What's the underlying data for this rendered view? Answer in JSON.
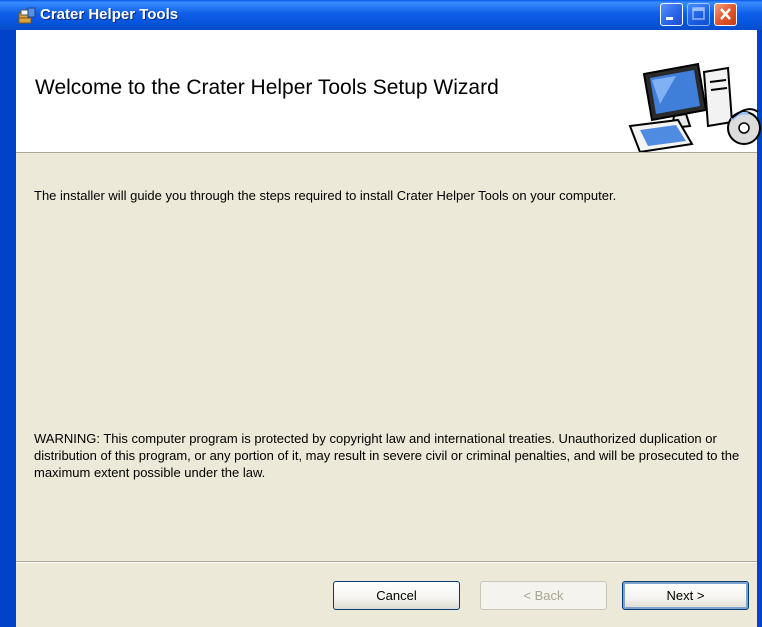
{
  "window": {
    "title": "Crater Helper Tools"
  },
  "banner": {
    "title": "Welcome to the Crater Helper Tools Setup Wizard",
    "art_icon": "computer-with-cd-icon"
  },
  "body": {
    "intro": "The installer will guide you through the steps required to install Crater Helper Tools on your computer.",
    "warning": "WARNING: This computer program is protected by copyright law and international treaties. Unauthorized duplication or distribution of this program, or any portion of it, may result in severe civil or criminal penalties, and will be prosecuted to the maximum extent possible under the law."
  },
  "buttons": {
    "cancel": "Cancel",
    "back": "< Back",
    "next": "Next >"
  },
  "colors": {
    "titlebar": "#0654d8",
    "client_bg": "#ece9d8",
    "close_button": "#e0582c"
  }
}
